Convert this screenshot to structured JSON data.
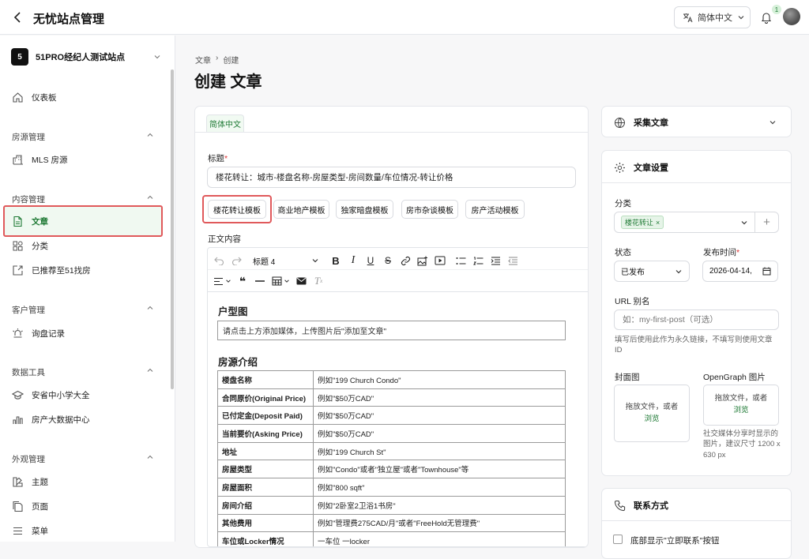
{
  "app": {
    "title": "无忧站点管理",
    "language": "简体中文",
    "notifications": "1"
  },
  "sidebar": {
    "site_initial": "5",
    "site_name": "51PRO经纪人测试站点",
    "dashboard": "仪表板",
    "sections": [
      {
        "title": "房源管理",
        "items": [
          "MLS 房源"
        ]
      },
      {
        "title": "内容管理",
        "items": [
          "文章",
          "分类",
          "已推荐至51找房"
        ]
      },
      {
        "title": "客户管理",
        "items": [
          "询盘记录"
        ]
      },
      {
        "title": "数据工具",
        "items": [
          "安省中小学大全",
          "房产大数据中心"
        ]
      },
      {
        "title": "外观管理",
        "items": [
          "主题",
          "页面",
          "菜单"
        ]
      }
    ]
  },
  "breadcrumb": {
    "parent": "文章",
    "current": "创建"
  },
  "page_title": "创建 文章",
  "editor_card": {
    "lang_tab": "简体中文",
    "title_label": "标题",
    "title_value": "楼花转让：城市-楼盘名称-房屋类型-房间数量/车位情况-转让价格",
    "templates": [
      "楼花转让模板",
      "商业地产模板",
      "独家暗盘模板",
      "房市杂谈模板",
      "房产活动模板"
    ],
    "content_label": "正文内容",
    "toolbar": {
      "heading": "标题 4"
    },
    "body": {
      "h_layout": "户型图",
      "media_placeholder": "请点击上方添加媒体，上传图片后\"添加至文章\"",
      "h_intro": "房源介绍",
      "rows": [
        {
          "k": "楼盘名称",
          "v": "例如\"199 Church Condo\""
        },
        {
          "k": "合同原价(Original Price)",
          "v": "例如\"$50万CAD\""
        },
        {
          "k": "已付定金(Deposit Paid)",
          "v": "例如\"$50万CAD\""
        },
        {
          "k": "当前要价(Asking Price)",
          "v": "例如\"$50万CAD\""
        },
        {
          "k": "地址",
          "v": "例如\"199 Church St\""
        },
        {
          "k": "房屋类型",
          "v": "例如\"Condo\"或者\"独立屋\"或者\"Townhouse\"等"
        },
        {
          "k": "房屋面积",
          "v": "例如\"800 sqft\""
        },
        {
          "k": "房间介绍",
          "v": "例如\"2卧室2卫浴1书房\""
        },
        {
          "k": "其他费用",
          "v": "例如\"管理费275CAD/月\"或者\"FreeHold无管理费\""
        },
        {
          "k": "车位或Locker情况",
          "v": "一车位 一locker"
        }
      ]
    }
  },
  "collect_card": {
    "title": "采集文章"
  },
  "settings_card": {
    "title": "文章设置",
    "category_label": "分类",
    "category_chip": "楼花转让",
    "status_label": "状态",
    "status_value": "已发布",
    "publish_label": "发布时间",
    "publish_value": "2026-04-14,",
    "slug_label": "URL 别名",
    "slug_placeholder": "如：my-first-post（可选）",
    "slug_help": "填写后使用此作为永久链接，不填写则使用文章 ID",
    "cover_label": "封面图",
    "og_label": "OpenGraph 图片",
    "drop_text": "拖放文件，或者",
    "drop_link": "浏览",
    "og_help": "社交媒体分享时显示的图片，建议尺寸 1200 x 630 px"
  },
  "contact_card": {
    "title": "联系方式",
    "checkbox_label": "底部显示\"立即联系\"按钮"
  },
  "colors": {
    "accent": "#1f7a35",
    "highlight": "#e0595b"
  }
}
